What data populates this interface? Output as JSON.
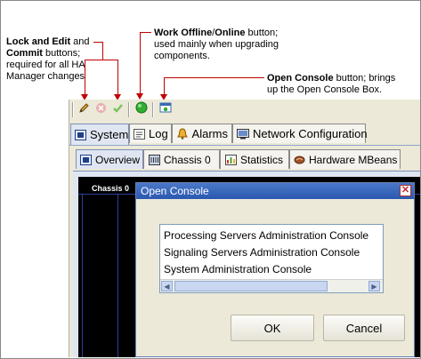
{
  "annotations": {
    "lock_commit": {
      "line1_bold": "Lock and Edit",
      "line1_rest": " and",
      "line2_bold": "Commit",
      "line2_rest": " buttons;",
      "line3": "required for all HA",
      "line4": "Manager changes"
    },
    "work_offline": {
      "line1_bold": "Work Offline",
      "line1_mid": "/",
      "line1_bold2": "Online",
      "line1_rest": " button;",
      "line2": "used mainly when upgrading",
      "line3": "components."
    },
    "open_console": {
      "line1_bold": "Open Console",
      "line1_rest": " button; brings",
      "line2": "up the Open Console Box."
    },
    "callout_color": "#c00000"
  },
  "toolbar": {
    "icons": [
      "pencil-icon",
      "cancel-icon",
      "checkmark-icon",
      "green-circle-icon",
      "console-icon"
    ]
  },
  "main_tabs": [
    {
      "label": "System",
      "icon": "system-icon",
      "active": true
    },
    {
      "label": "Log",
      "icon": "log-icon",
      "active": false
    },
    {
      "label": "Alarms",
      "icon": "bell-icon",
      "active": false
    },
    {
      "label": "Network Configuration",
      "icon": "network-icon",
      "active": false
    }
  ],
  "sub_tabs": [
    {
      "label": "Overview",
      "icon": "overview-icon",
      "active": true
    },
    {
      "label": "Chassis 0",
      "icon": "chassis-icon",
      "active": false
    },
    {
      "label": "Statistics",
      "icon": "statistics-icon",
      "active": false
    },
    {
      "label": "Hardware MBeans",
      "icon": "bean-icon",
      "active": false
    }
  ],
  "chassis_label": "Chassis 0",
  "dialog": {
    "title": "Open Console",
    "items": [
      "Processing Servers Administration Console",
      "Signaling Servers Administration Console",
      "System Administration Console"
    ],
    "ok_label": "OK",
    "cancel_label": "Cancel"
  }
}
